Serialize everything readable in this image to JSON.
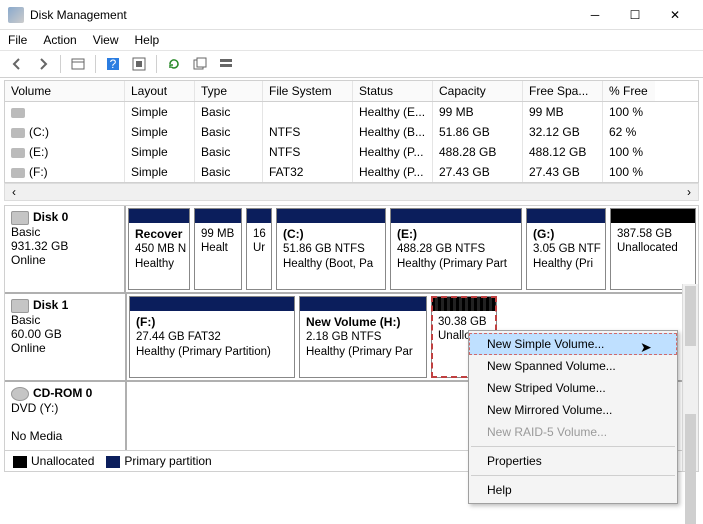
{
  "window": {
    "title": "Disk Management"
  },
  "menu": {
    "file": "File",
    "action": "Action",
    "view": "View",
    "help": "Help"
  },
  "table": {
    "headers": {
      "volume": "Volume",
      "layout": "Layout",
      "type": "Type",
      "fs": "File System",
      "status": "Status",
      "capacity": "Capacity",
      "free": "Free Spa...",
      "pct": "% Free"
    },
    "rows": [
      {
        "vol": "",
        "layout": "Simple",
        "type": "Basic",
        "fs": "",
        "status": "Healthy (E...",
        "cap": "99 MB",
        "free": "99 MB",
        "pct": "100 %"
      },
      {
        "vol": "(C:)",
        "layout": "Simple",
        "type": "Basic",
        "fs": "NTFS",
        "status": "Healthy (B...",
        "cap": "51.86 GB",
        "free": "32.12 GB",
        "pct": "62 %"
      },
      {
        "vol": "(E:)",
        "layout": "Simple",
        "type": "Basic",
        "fs": "NTFS",
        "status": "Healthy (P...",
        "cap": "488.28 GB",
        "free": "488.12 GB",
        "pct": "100 %"
      },
      {
        "vol": "(F:)",
        "layout": "Simple",
        "type": "Basic",
        "fs": "FAT32",
        "status": "Healthy (P...",
        "cap": "27.43 GB",
        "free": "27.43 GB",
        "pct": "100 %"
      }
    ]
  },
  "disks": {
    "d0": {
      "name": "Disk 0",
      "type": "Basic",
      "size": "931.32 GB",
      "state": "Online",
      "parts": [
        {
          "cap": "navy",
          "title": "Recover",
          "line2": "450 MB N",
          "line3": "Healthy"
        },
        {
          "cap": "navy",
          "title": "",
          "line2": "99 MB",
          "line3": "Healt"
        },
        {
          "cap": "navy",
          "title": "",
          "line2": "16",
          "line3": "Ur"
        },
        {
          "cap": "navy",
          "title": "(C:)",
          "line2": "51.86 GB NTFS",
          "line3": "Healthy (Boot, Pa"
        },
        {
          "cap": "navy",
          "title": "(E:)",
          "line2": "488.28 GB NTFS",
          "line3": "Healthy (Primary Part"
        },
        {
          "cap": "navy",
          "title": "(G:)",
          "line2": "3.05 GB NTF",
          "line3": "Healthy (Pri"
        },
        {
          "cap": "black",
          "title": "",
          "line2": "387.58 GB",
          "line3": "Unallocated"
        }
      ]
    },
    "d1": {
      "name": "Disk 1",
      "type": "Basic",
      "size": "60.00 GB",
      "state": "Online",
      "parts": [
        {
          "cap": "navy",
          "title": "(F:)",
          "line2": "27.44 GB FAT32",
          "line3": "Healthy (Primary Partition)"
        },
        {
          "cap": "navy",
          "title": "New Volume  (H:)",
          "line2": "2.18 GB NTFS",
          "line3": "Healthy (Primary Par"
        },
        {
          "cap": "black",
          "title": "",
          "line2": "30.38 GB",
          "line3": "Unallocat"
        }
      ]
    },
    "cd": {
      "name": "CD-ROM 0",
      "type": "DVD (Y:)",
      "state": "No Media"
    }
  },
  "legend": {
    "unalloc": "Unallocated",
    "primary": "Primary partition"
  },
  "context": {
    "new_simple": "New Simple Volume...",
    "new_spanned": "New Spanned Volume...",
    "new_striped": "New Striped Volume...",
    "new_mirrored": "New Mirrored Volume...",
    "new_raid5": "New RAID-5 Volume...",
    "properties": "Properties",
    "help": "Help"
  }
}
